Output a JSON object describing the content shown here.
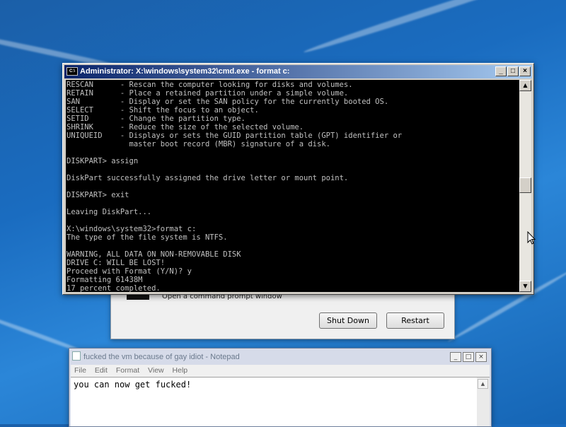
{
  "recovery_dialog": {
    "option_label": "Open a command prompt window",
    "shutdown_label": "Shut Down",
    "restart_label": "Restart"
  },
  "cmd": {
    "title": "Administrator: X:\\windows\\system32\\cmd.exe - format  c:",
    "icon_label": "C:\\",
    "controls": {
      "minimize": "_",
      "maximize": "□",
      "close": "×"
    },
    "lines": [
      "RESCAN      - Rescan the computer looking for disks and volumes.",
      "RETAIN      - Place a retained partition under a simple volume.",
      "SAN         - Display or set the SAN policy for the currently booted OS.",
      "SELECT      - Shift the focus to an object.",
      "SETID       - Change the partition type.",
      "SHRINK      - Reduce the size of the selected volume.",
      "UNIQUEID    - Displays or sets the GUID partition table (GPT) identifier or",
      "              master boot record (MBR) signature of a disk.",
      "",
      "DISKPART> assign",
      "",
      "DiskPart successfully assigned the drive letter or mount point.",
      "",
      "DISKPART> exit",
      "",
      "Leaving DiskPart...",
      "",
      "X:\\windows\\system32>format c:",
      "The type of the file system is NTFS.",
      "",
      "WARNING, ALL DATA ON NON-REMOVABLE DISK",
      "DRIVE C: WILL BE LOST!",
      "Proceed with Format (Y/N)? y",
      "Formatting 61438M",
      "17 percent completed."
    ]
  },
  "notepad": {
    "title": "fucked the vm because of gay idiot - Notepad",
    "controls": {
      "minimize": "_",
      "maximize": "□",
      "close": "×"
    },
    "menu": [
      "File",
      "Edit",
      "Format",
      "View",
      "Help"
    ],
    "content": "you can now get fucked!"
  },
  "colors": {
    "console_bg": "#000000",
    "console_fg": "#c0c0c0",
    "titlebar_start": "#0a246a",
    "desktop": "#1a6cc0"
  }
}
